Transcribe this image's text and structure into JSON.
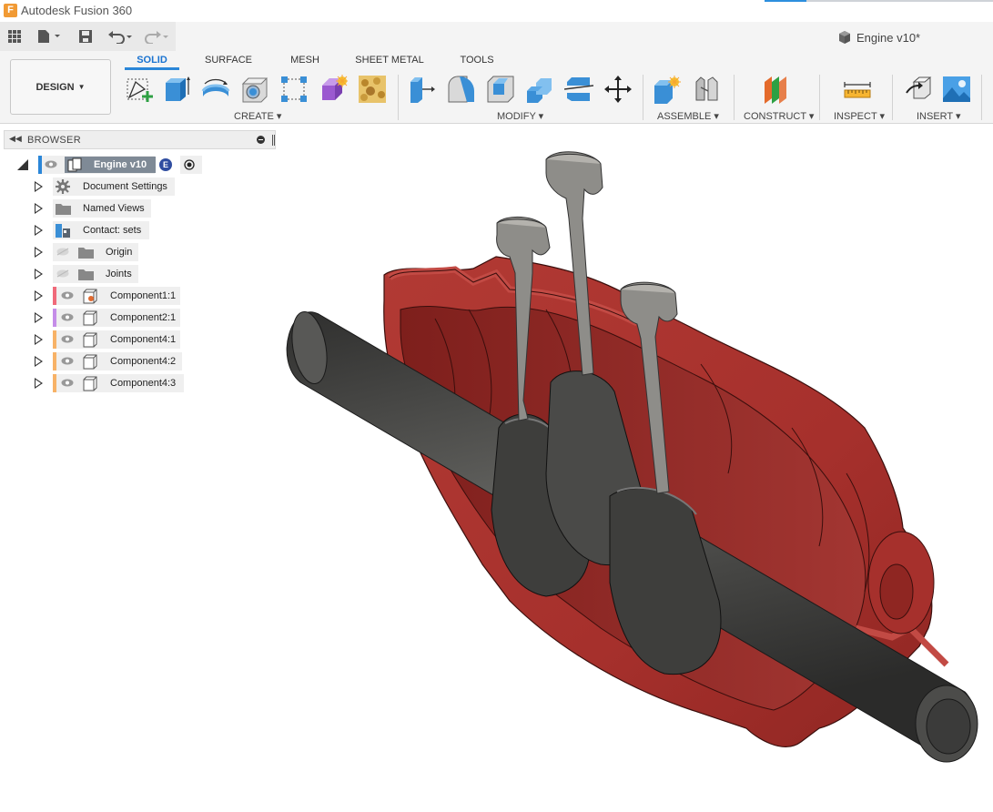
{
  "window": {
    "app_title": "Autodesk Fusion 360",
    "logo_letter": "F",
    "document_title": "Engine v10*"
  },
  "workspace": {
    "label": "DESIGN"
  },
  "tabs": [
    {
      "label": "SOLID",
      "active": true
    },
    {
      "label": "SURFACE",
      "active": false
    },
    {
      "label": "MESH",
      "active": false
    },
    {
      "label": "SHEET METAL",
      "active": false
    },
    {
      "label": "TOOLS",
      "active": false
    }
  ],
  "groups": {
    "create": "CREATE",
    "modify": "MODIFY",
    "assemble": "ASSEMBLE",
    "construct": "CONSTRUCT",
    "inspect": "INSPECT",
    "insert": "INSERT"
  },
  "browser": {
    "title": "BROWSER",
    "root": {
      "label": "Engine v10",
      "badge": "E"
    },
    "items": [
      {
        "label": "Document Settings",
        "icon": "gear-icon"
      },
      {
        "label": "Named Views",
        "icon": "folder-icon"
      },
      {
        "label": "Contact: sets",
        "icon": "contact-sets-icon"
      },
      {
        "label": "Origin",
        "icon": "folder-icon"
      },
      {
        "label": "Joints",
        "icon": "folder-icon"
      },
      {
        "label": "Component1:1",
        "icon": "component-icon",
        "color": "#f06a7a"
      },
      {
        "label": "Component2:1",
        "icon": "component-icon",
        "color": "#c58de8"
      },
      {
        "label": "Component4:1",
        "icon": "component-icon",
        "color": "#f7b267"
      },
      {
        "label": "Component4:2",
        "icon": "component-icon",
        "color": "#f7b267"
      },
      {
        "label": "Component4:3",
        "icon": "component-icon",
        "color": "#f7b267"
      }
    ]
  },
  "colors": {
    "accent": "#2a86d8",
    "housing": "#a6302c",
    "shaft": "#4d4d4b",
    "valve": "#8e8d89"
  }
}
